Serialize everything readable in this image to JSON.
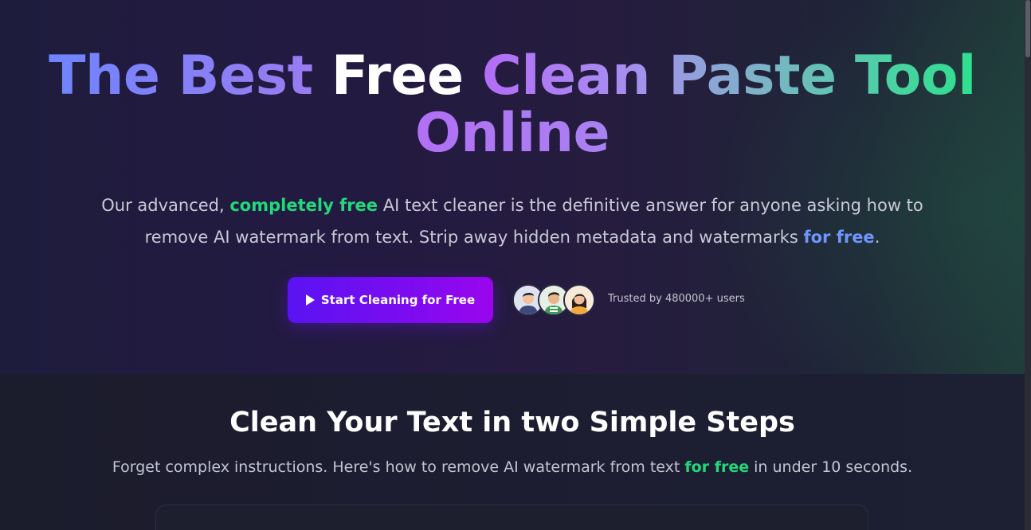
{
  "hero": {
    "title_part1": "The Best",
    "title_part2": "Free",
    "title_part3": "Clean Paste Tool",
    "title_part4": "Online",
    "description_before": "Our advanced, ",
    "description_highlight1": "completely free",
    "description_middle": " AI text cleaner is the definitive answer for anyone asking how to remove AI watermark from text. Strip away hidden metadata and watermarks ",
    "description_highlight2": "for free",
    "description_after": ".",
    "cta_label": "Start Cleaning for Free",
    "cta_icon": "play-icon",
    "trusted_text": "Trusted by 480000+ users"
  },
  "steps": {
    "title": "Clean Your Text in two Simple Steps",
    "subtitle_before": "Forget complex instructions. Here's how to remove AI watermark from text ",
    "subtitle_highlight": "for free",
    "subtitle_after": " in under 10 seconds."
  },
  "colors": {
    "accent_green": "#22d97a",
    "accent_blue": "#6f96ff",
    "cta_start": "#5a13f2",
    "cta_end": "#9a06ee"
  }
}
